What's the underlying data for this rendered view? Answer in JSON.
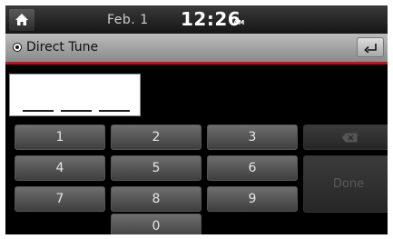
{
  "status_bar": {
    "home_icon": "home-icon",
    "date": "Feb.  1",
    "time": "12:26",
    "ampm": "AM"
  },
  "title_bar": {
    "title": "Direct Tune",
    "mode_icon": "radio-indicator-icon",
    "back_icon": "back-arrow-icon",
    "accent_color": "#b0191e"
  },
  "entry": {
    "value": "",
    "slots": 3
  },
  "keypad": {
    "keys": [
      "1",
      "2",
      "3",
      "4",
      "5",
      "6",
      "7",
      "8",
      "9",
      "0"
    ],
    "delete_icon": "backspace-icon",
    "done_label": "Done",
    "delete_enabled": false,
    "done_enabled": false
  }
}
